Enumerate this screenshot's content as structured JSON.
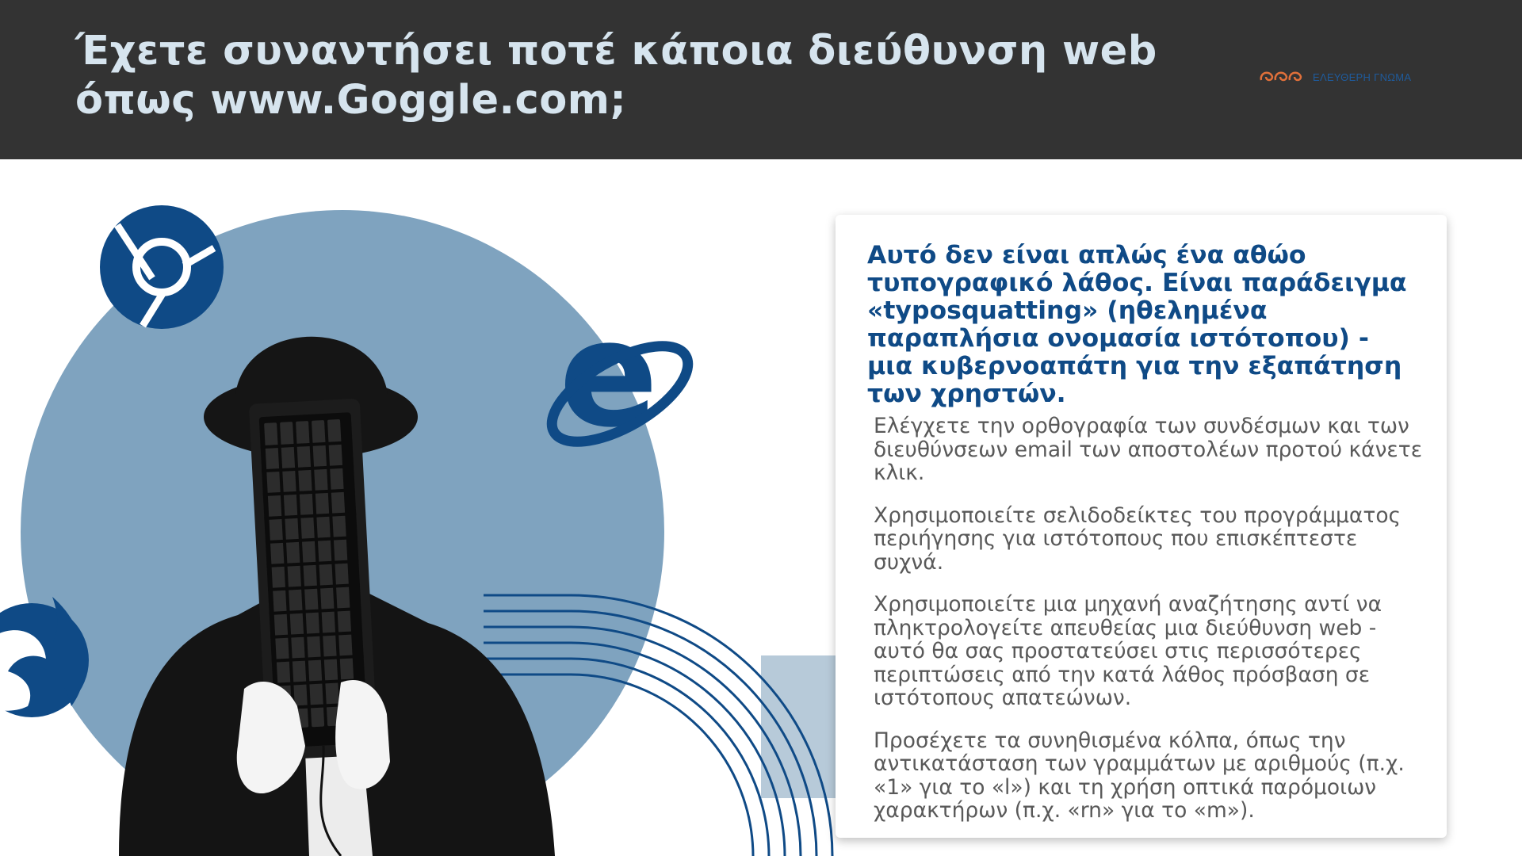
{
  "header": {
    "title": "Έχετε συναντήσει ποτέ κάποια διεύθυνση web όπως www.Goggle.com;",
    "logo_text": "ΕΛΕΥΘΕΡΗ ΓΝΩΜΑ"
  },
  "card": {
    "heading": "Αυτό δεν είναι απλώς ένα αθώο τυπογραφικό λάθος. Είναι παράδειγμα «typosquatting» (ηθελημένα παραπλήσια ονομασία ιστότοπου) - μια κυβερνοαπάτη για την εξαπάτηση των χρηστών.",
    "tips": [
      "Ελέγχετε την ορθογραφία των συνδέσμων και των διευθύνσεων email των αποστολέων προτού κάνετε κλικ.",
      "Χρησιμοποιείτε σελιδοδείκτες του προγράμματος περιήγησης για ιστότοπους που επισκέπτεστε συχνά.",
      "Χρησιμοποιείτε μια μηχανή αναζήτησης αντί να πληκτρολογείτε απευθείας μια διεύθυνση web - αυτό θα σας προστατεύσει στις περισσότερες περιπτώσεις από την κατά λάθος πρόσβαση σε ιστότοπους απατεώνων.",
      "Προσέχετε τα συνηθισμένα κόλπα, όπως την αντικατάσταση των γραμμάτων με αριθμούς (π.χ. «1» για το «l») και τη χρήση οπτικά παρόμοιων χαρακτήρων (π.χ. «rn» για το «m»)."
    ]
  },
  "icons": [
    "chrome-icon",
    "internet-explorer-icon",
    "firefox-icon",
    "keyboard-icon"
  ],
  "colors": {
    "header_bg": "#333333",
    "title": "#d6e4ee",
    "accent_blue": "#0f4a86",
    "circle": "#7fa3bf",
    "body_text": "#595959",
    "logo_orange": "#e0703a"
  }
}
